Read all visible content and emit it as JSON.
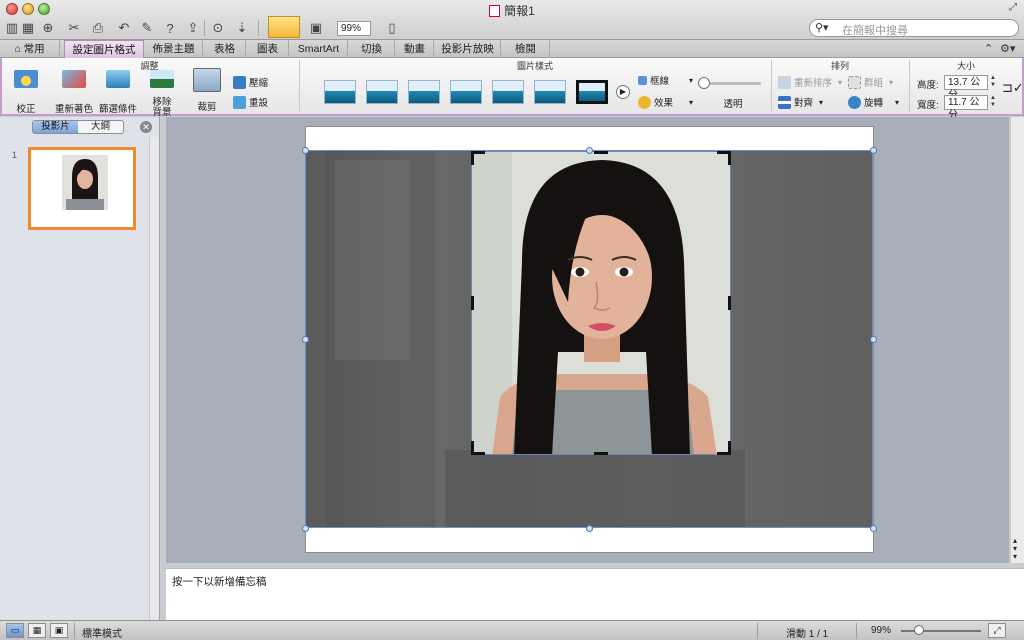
{
  "window": {
    "title": "簡報1"
  },
  "toolbar": {
    "zoom_value": "99%",
    "search_placeholder": "在簡報中搜尋"
  },
  "tabs": [
    {
      "label": "常用",
      "active": false
    },
    {
      "label": "設定圖片格式",
      "active": true
    },
    {
      "label": "佈景主題",
      "active": false
    },
    {
      "label": "表格",
      "active": false
    },
    {
      "label": "圖表",
      "active": false
    },
    {
      "label": "SmartArt",
      "active": false
    },
    {
      "label": "切換",
      "active": false
    },
    {
      "label": "動畫",
      "active": false
    },
    {
      "label": "投影片放映",
      "active": false
    },
    {
      "label": "檢閱",
      "active": false
    }
  ],
  "ribbon": {
    "groups": {
      "adjust": "調整",
      "picture_styles": "圖片樣式",
      "arrange": "排列",
      "size": "大小"
    },
    "adjust": {
      "corrections": "校正",
      "recolor": "重新著色",
      "filters": "篩選條件",
      "remove_bg_line1": "移除",
      "remove_bg_line2": "背景",
      "crop": "裁剪",
      "compress": "壓縮",
      "reset": "重設"
    },
    "styles": {
      "border": "框線",
      "effects": "效果",
      "transparency": "透明"
    },
    "arrange": {
      "reorder": "重新排序",
      "group": "群組",
      "align": "對齊",
      "rotate": "旋轉"
    },
    "size": {
      "height_label": "高度:",
      "height_value": "13.7 公分",
      "width_label": "寬度:",
      "width_value": "11.7 公分"
    }
  },
  "left_pane": {
    "tab_slides": "投影片",
    "tab_outline": "大綱",
    "slide_number": "1"
  },
  "notes": {
    "placeholder": "按一下以新增備忘稿"
  },
  "status": {
    "view_mode": "標準模式",
    "slide_position": "滑動 1 / 1",
    "zoom": "99%"
  },
  "colors": {
    "ribbon_accent": "#c79bd0",
    "thumbnail_selected": "#f08a2c",
    "selection_handle": "#5479b3"
  }
}
